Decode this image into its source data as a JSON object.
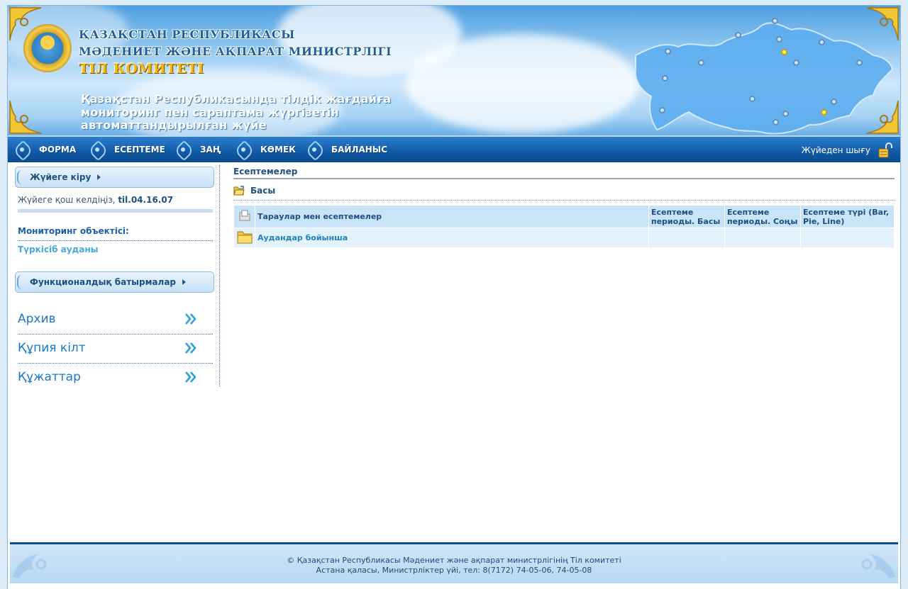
{
  "banner": {
    "title_line1": "ҚАЗАҚСТАН РЕСПУБЛИКАСЫ",
    "title_line2": "МӘДЕНИЕТ ЖӘНЕ АҚПАРАТ МИНИСТРЛІГІ",
    "title_line3": "ТІЛ КОМИТЕТІ",
    "slogan_line1": "Қазақстан Республикасында тілдік жағдайға",
    "slogan_line2": "мониторинг пен сараптама жүргізетін",
    "slogan_line3": "автоматтандырылған жүйе"
  },
  "nav": {
    "items": [
      {
        "label": "ФОРМА"
      },
      {
        "label": "ЕСЕПТЕМЕ"
      },
      {
        "label": "ЗАҢ"
      },
      {
        "label": "КӨМЕК"
      },
      {
        "label": "БАЙЛАНЫС"
      }
    ],
    "logout_label": "Жүйеден шығу"
  },
  "sidebar": {
    "login_panel_title": "Жүйеге кіру",
    "welcome_text": "Жүйеге қош келдіңіз,",
    "username": "til.04.16.07",
    "monitoring_label": "Мониторинг объектісі:",
    "monitoring_value": "Түркісіб ауданы",
    "func_panel_title": "Функционалдық батырмалар",
    "func_items": [
      {
        "label": "Архив"
      },
      {
        "label": "Құпия кілт"
      },
      {
        "label": "Құжаттар"
      }
    ]
  },
  "main": {
    "title": "Есептемелер",
    "breadcrumb": "Басы",
    "table": {
      "headers": [
        "Тараулар мен есептемелер",
        "Есептеме периоды. Басы",
        "Есептеме периоды. Соңы",
        "Есептеме түрі (Bar, Pie, Line)"
      ],
      "rows": [
        {
          "name": "Аудандар бойынша",
          "start": "",
          "end": "",
          "type": ""
        }
      ]
    }
  },
  "footer": {
    "line1": "© Қазақстан Республикасы Мәдениет және ақпарат министрлігінің Тіл комитеті",
    "line2": "Астана қаласы, Министрліктер үйі, тел: 8(7172) 74-05-06, 74-05-08"
  },
  "colors": {
    "nav_bg": "#125ca8",
    "accent": "#1a78c8",
    "header_text": "#1e4f80"
  }
}
